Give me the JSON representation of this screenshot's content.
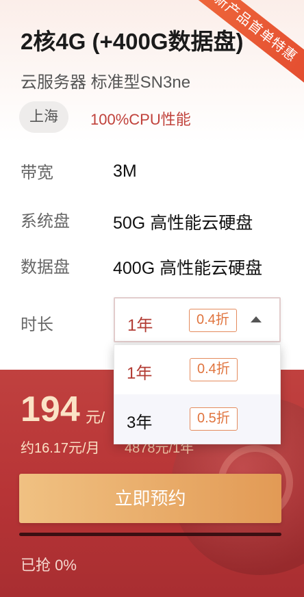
{
  "card": {
    "ribbon": "新产品首单特惠",
    "title": "2核4G (+400G数据盘)",
    "subtitle": "云服务器 标准型SN3ne",
    "region": "上海",
    "feature": "100%CPU性能"
  },
  "specs": [
    {
      "label": "带宽",
      "value": "3M"
    },
    {
      "label": "系统盘",
      "value": "50G 高性能云硬盘"
    },
    {
      "label": "数据盘",
      "value": "400G 高性能云硬盘"
    }
  ],
  "duration": {
    "label": "时长",
    "selected": "1年",
    "selected_discount": "0.4折",
    "options": [
      {
        "label": "1年",
        "discount": "0.4折"
      },
      {
        "label": "3年",
        "discount": "0.5折"
      }
    ]
  },
  "pricing": {
    "price": "194",
    "unit": "元/",
    "monthly": "约16.17元/月",
    "original": "4878元/1年"
  },
  "cta": {
    "label": "立即预约"
  },
  "stock": {
    "sold_label": "已抢 0%",
    "progress_fraction": 0
  },
  "colors": {
    "accent_red": "#c0413a",
    "discount_orange": "#e0743e",
    "button_gold": "#e29a55",
    "panel_red": "#b73436"
  }
}
